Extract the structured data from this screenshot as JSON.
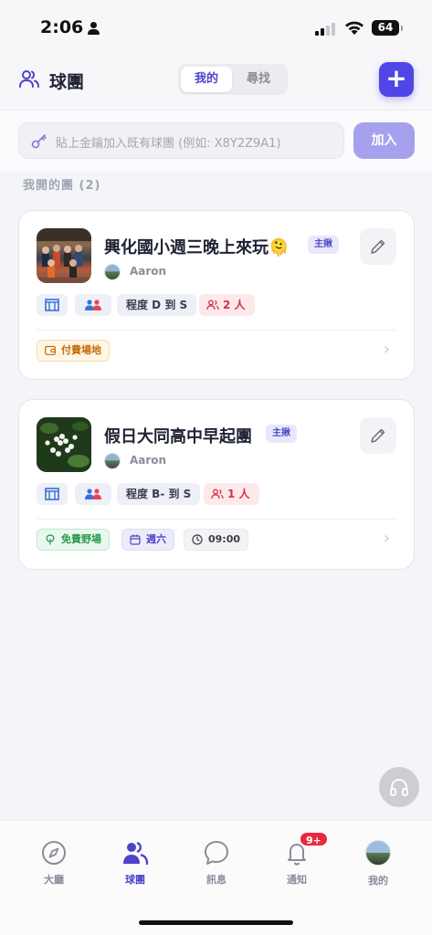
{
  "status_bar": {
    "time": "2:06",
    "battery": "64"
  },
  "header": {
    "title": "球團",
    "segments": [
      {
        "label": "我的"
      },
      {
        "label": "尋找"
      }
    ],
    "add_label": "+"
  },
  "join": {
    "placeholder": "貼上金鑰加入既有球團 (例如: X8Y2Z9A1)",
    "button": "加入"
  },
  "section_label": "我開的團 (2)",
  "groups": [
    {
      "name": "興化國小週三晚上來玩🫠",
      "host_tag": "主揪",
      "owner": "Aaron",
      "level": "程度 D 到 S",
      "count": "2 人",
      "tags": [
        {
          "label": "付費場地",
          "kind": "paid"
        }
      ]
    },
    {
      "name": "假日大同高中早起團",
      "host_tag": "主揪",
      "owner": "Aaron",
      "level": "程度 B- 到 S",
      "count": "1 人",
      "tags": [
        {
          "label": "免費野場",
          "kind": "free"
        },
        {
          "label": "週六",
          "kind": "day"
        },
        {
          "label": "09:00",
          "kind": "time"
        }
      ]
    }
  ],
  "tabbar": {
    "items": [
      {
        "label": "大廳",
        "icon": "compass-icon"
      },
      {
        "label": "球團",
        "icon": "people-icon"
      },
      {
        "label": "訊息",
        "icon": "chat-bubble-icon"
      },
      {
        "label": "通知",
        "icon": "bell-icon",
        "badge": "9+"
      },
      {
        "label": "我的",
        "icon": "avatar"
      }
    ]
  },
  "colors": {
    "accent": "#4f46e5",
    "badge": "#e8293f"
  }
}
